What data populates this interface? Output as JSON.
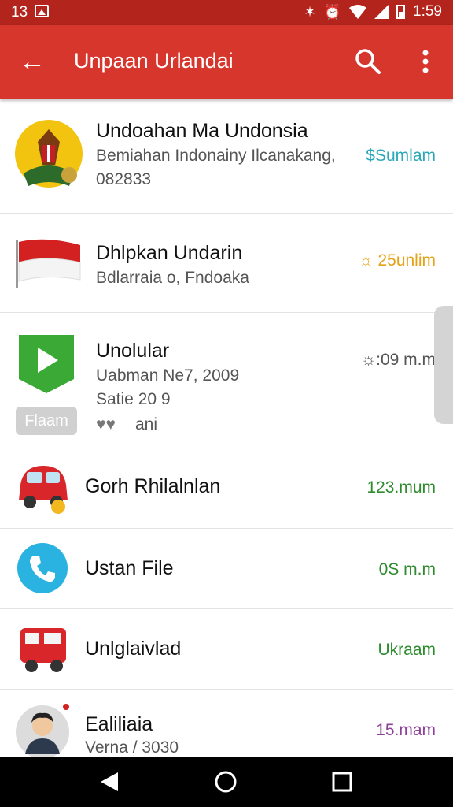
{
  "status_bar": {
    "time_left": "13",
    "time_right": "1:59",
    "icons": [
      "image-icon",
      "bluetooth-icon",
      "alarm-icon",
      "wifi-icon",
      "signal-icon",
      "battery-icon"
    ]
  },
  "app_bar": {
    "title": "Unpaan Urlandai",
    "color": "#d7362d",
    "status_color": "#b3241c"
  },
  "list": {
    "items": [
      {
        "title": "Undoahan Ma Undonsia",
        "subtitle": "Bemiahan Indonainy Ilcanakang,",
        "subtitle2": "082833",
        "meta": "$Sumlam",
        "meta_color": "#2aa8b8",
        "icon": "emblem-icon"
      },
      {
        "title": "Dhlpkan Undarin",
        "subtitle": "Bdlarraia o, Fndoaka",
        "meta": "☼ 25unlim",
        "meta_color": "#e5a317",
        "icon": "flag-icon"
      },
      {
        "title": "Unolular",
        "subtitle": "Uabman Ne7, 2009",
        "subtitle2": "Satie 20 9",
        "extra": "ani",
        "tag": "Flaam",
        "meta": "☼:09 m.m",
        "meta_color": "#555555",
        "icon": "play-icon"
      },
      {
        "title": "Gorh Rhilalnlan",
        "meta": "123.mum",
        "meta_color": "#2e8b2e",
        "icon": "car-icon"
      },
      {
        "title": "Ustan File",
        "meta": "0S m.m",
        "meta_color": "#2e8b2e",
        "icon": "phone-icon"
      },
      {
        "title": "Unlglaivlad",
        "meta": "Ukraam",
        "meta_color": "#2e8b2e",
        "icon": "bus-icon"
      },
      {
        "title": "Ealiliaia",
        "subtitle": "Verna / 3030",
        "meta": "15.mam",
        "meta_color": "#8e3f9a",
        "icon": "person-icon"
      }
    ]
  }
}
